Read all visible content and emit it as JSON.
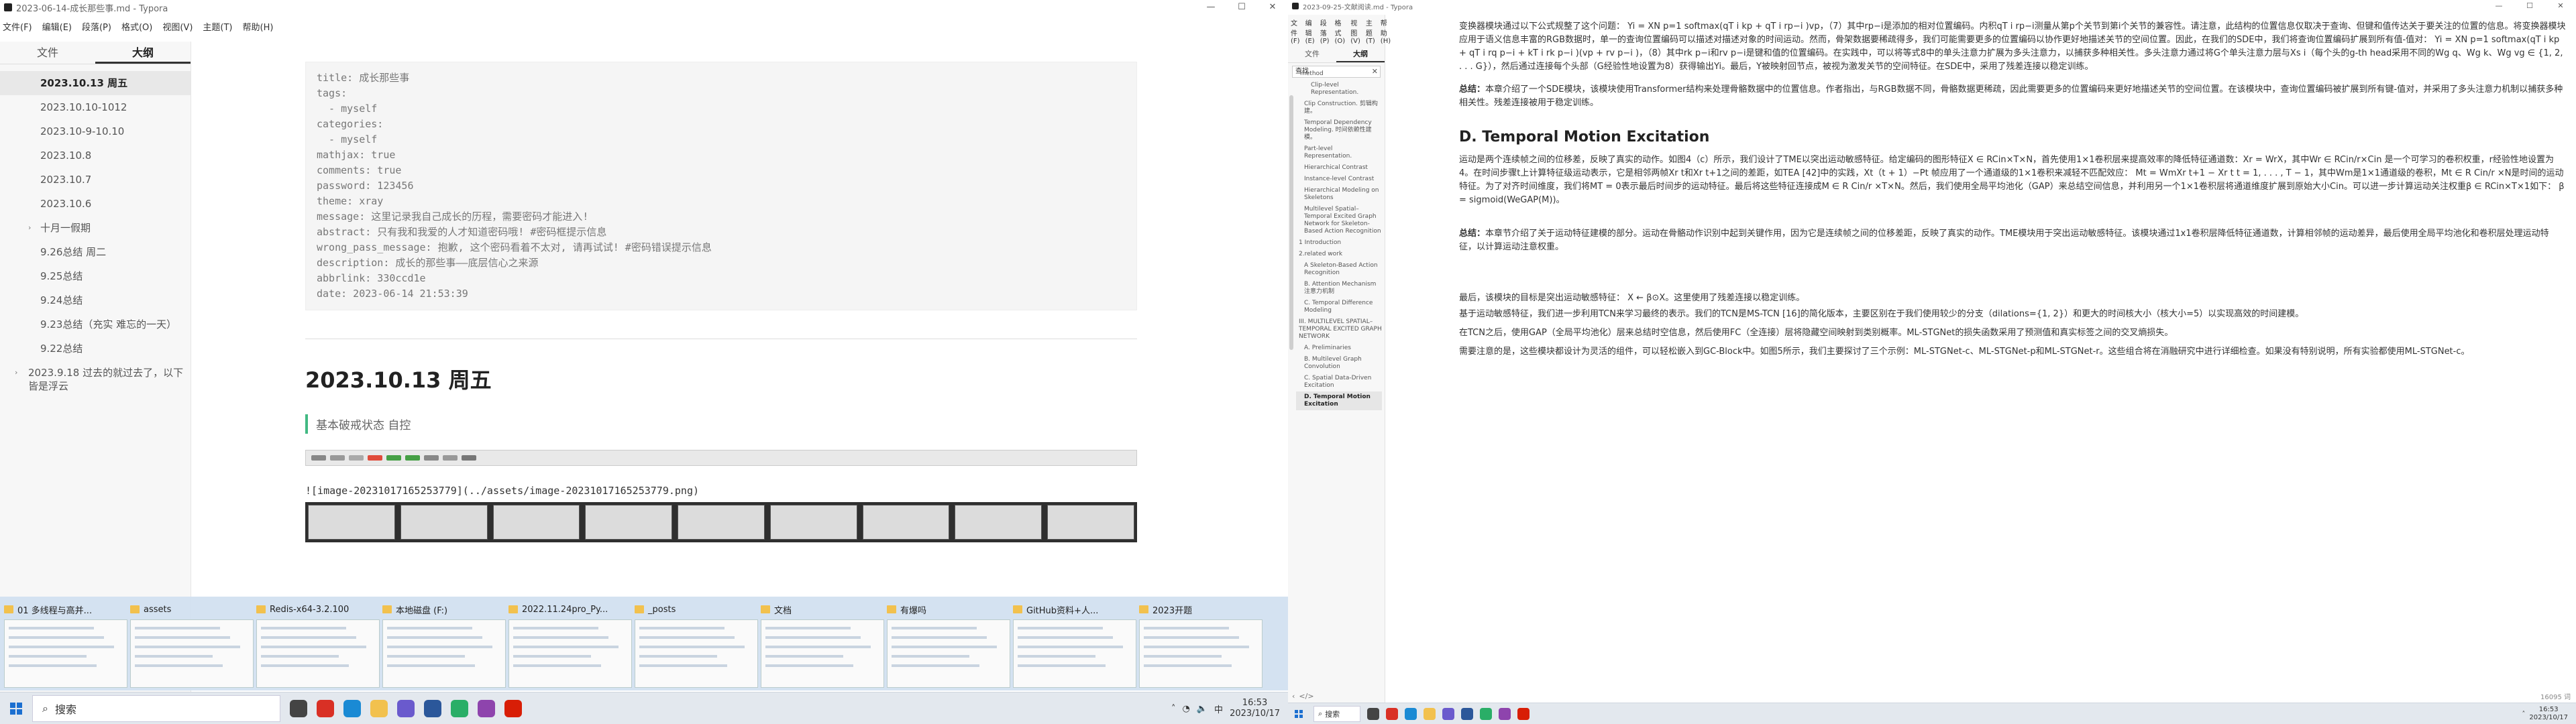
{
  "left_window": {
    "title": "2023-06-14-成长那些事.md - Typora",
    "menu": [
      "文件(F)",
      "编辑(E)",
      "段落(P)",
      "格式(O)",
      "视图(V)",
      "主题(T)",
      "帮助(H)"
    ],
    "sidebar_tabs": [
      "文件",
      "大纲"
    ],
    "active_tab": "大纲",
    "outline": [
      {
        "label": "2023.10.13 周五",
        "active": true,
        "level": 2,
        "caret": false
      },
      {
        "label": "2023.10.10-1012",
        "active": false,
        "level": 2,
        "caret": false
      },
      {
        "label": "2023.10-9-10.10",
        "active": false,
        "level": 2,
        "caret": false
      },
      {
        "label": "2023.10.8",
        "active": false,
        "level": 2,
        "caret": false
      },
      {
        "label": "2023.10.7",
        "active": false,
        "level": 2,
        "caret": false
      },
      {
        "label": "2023.10.6",
        "active": false,
        "level": 2,
        "caret": false
      },
      {
        "label": "十月一假期",
        "active": false,
        "level": 2,
        "caret": true
      },
      {
        "label": "9.26总结 周二",
        "active": false,
        "level": 2,
        "caret": false
      },
      {
        "label": "9.25总结",
        "active": false,
        "level": 2,
        "caret": false
      },
      {
        "label": "9.24总结",
        "active": false,
        "level": 2,
        "caret": false
      },
      {
        "label": "9.23总结（充实 难忘的一天）",
        "active": false,
        "level": 2,
        "caret": false
      },
      {
        "label": "9.22总结",
        "active": false,
        "level": 2,
        "caret": false
      },
      {
        "label": "2023.9.18 过去的就过去了，以下皆是浮云",
        "active": false,
        "level": 1,
        "caret": true
      }
    ],
    "front_matter": [
      "title: 成长那些事",
      "tags:",
      "  - myself",
      "categories:",
      "  - myself",
      "mathjax: true",
      "comments: true",
      "password: 123456",
      "theme: xray",
      "message: 这里记录我自己成长的历程，需要密码才能进入!",
      "abstract: 只有我和我爱的人才知道密码哦! #密码框提示信息",
      "wrong_pass_message: 抱歉, 这个密码看着不太对, 请再试试! #密码错误提示信息",
      "description: 成长的那些事——底层信心之来源",
      "abbrlink: 330ccd1e",
      "date: 2023-06-14 21:53:39"
    ],
    "heading": "2023.10.13 周五",
    "quote": "基本破戒状态 自控",
    "image_ref": "![image-20231017165253779](../assets/image-20231017165253779.png)"
  },
  "thumbnails": [
    {
      "label": "01 多线程与高并...",
      "icon": "folder-icon"
    },
    {
      "label": "assets",
      "icon": "folder-icon"
    },
    {
      "label": "Redis-x64-3.2.100",
      "icon": "folder-icon"
    },
    {
      "label": "本地磁盘 (F:)",
      "icon": "drive-icon"
    },
    {
      "label": "2022.11.24pro_Py...",
      "icon": "folder-icon"
    },
    {
      "label": "_posts",
      "icon": "folder-icon"
    },
    {
      "label": "文档",
      "icon": "folder-icon"
    },
    {
      "label": "有爆吗",
      "icon": "folder-icon"
    },
    {
      "label": "GitHub资料+人...",
      "icon": "folder-icon"
    },
    {
      "label": "2023开题",
      "icon": "folder-icon"
    }
  ],
  "taskbar": {
    "search_placeholder": "搜索",
    "time": "16:53",
    "date": "2023/10/17",
    "lang": "中",
    "icons": [
      {
        "name": "task-view-icon",
        "color": "#444444"
      },
      {
        "name": "chrome-icon",
        "color": "#d93025"
      },
      {
        "name": "edge-icon",
        "color": "#1a8ad4"
      },
      {
        "name": "file-explorer-icon",
        "color": "#f2c14e"
      },
      {
        "name": "typora-icon",
        "color": "#6a5acd"
      },
      {
        "name": "app-icon",
        "color": "#2b579a"
      },
      {
        "name": "wechat-icon",
        "color": "#2aae67"
      },
      {
        "name": "app2-icon",
        "color": "#8e44ad"
      },
      {
        "name": "netease-music-icon",
        "color": "#d81e06"
      }
    ]
  },
  "right_window": {
    "title": "2023-09-25-文献阅读.md - Typora",
    "menu": [
      "文件(F)",
      "编辑(E)",
      "段落(P)",
      "格式(O)",
      "视图(V)",
      "主题(T)",
      "帮助(H)"
    ],
    "sidebar_tabs": [
      "文件",
      "大纲"
    ],
    "search_value": "查找",
    "outline": [
      {
        "label": "method",
        "active": false
      },
      {
        "label": "Clip-level Representation.",
        "active": false
      },
      {
        "label": "Clip Construction. 剪辑构建。",
        "active": false
      },
      {
        "label": "Temporal Dependency Modeling. 时间依赖性建模。",
        "active": false
      },
      {
        "label": "Part-level Representation.",
        "active": false
      },
      {
        "label": "Hierarchical Contrast",
        "active": false
      },
      {
        "label": "Instance-level Contrast",
        "active": false
      },
      {
        "label": "Hierarchical Modeling on Skeletons",
        "active": false
      },
      {
        "label": "Multilevel Spatial–Temporal Excited Graph Network for Skeleton-Based Action Recognition",
        "active": false
      },
      {
        "label": "1 Introduction",
        "active": false
      },
      {
        "label": "2.related work",
        "active": false
      },
      {
        "label": "A Skeleton-Based Action Recognition",
        "active": false
      },
      {
        "label": "B. Attention Mechanism 注意力机制",
        "active": false
      },
      {
        "label": "C. Temporal Difference Modeling",
        "active": false
      },
      {
        "label": "III. MULTILEVEL SPATIAL–TEMPORAL EXCITED GRAPH NETWORK",
        "active": false
      },
      {
        "label": "A. Preliminaries",
        "active": false
      },
      {
        "label": "B. Multilevel Graph Convolution",
        "active": false
      },
      {
        "label": "C. Spatial Data-Driven Excitation",
        "active": false
      },
      {
        "label": "D. Temporal Motion Excitation",
        "active": true
      }
    ],
    "para1": "变换器模块通过以下公式规整了这个问题： Yi = XN p=1 softmax(qT i kp + qT i rp−i )vp，（7）其中rp−i是添加的相对位置编码。内积qT i rp−i测量从第p个关节到第i个关节的兼容性。请注意，此结构的位置信息仅取决于查询、但键和值传达关于要关注的位置的信息。将变换器模块应用于语义信息丰富的RGB数据时，单一的查询位置编码可以描述对描述对象的时间运动。然而，骨架数据要稀疏得多，我们可能需要更多的位置编码以协作更好地描述关节的空间位置。因此，在我们的SDE中，我们将查询位置编码扩展到所有值-值对： Yi = XN p=1 softmax(qT i kp + qT i rq p−i + kT i rk p−i )(vp + rv p−i )，（8）其中rk p−i和rv p−i是键和值的位置编码。在实践中，可以将等式8中的单头注意力扩展为多头注意力，以捕获多种相关性。多头注意力通过将G个单头注意力层与Xs i（每个头的g-th head采用不同的Wg q、Wg k、Wg vg ∈ {1, 2, . . . G}），然后通过连接每个头部（G经验性地设置为8）获得输出Yi。最后，Y被映射回节点，被视为激发关节的空间特征。在SDE中，采用了残差连接以稳定训练。",
    "summary1": "本章介绍了一个SDE模块，该模块使用Transformer结构来处理骨骼数据中的位置信息。作者指出，与RGB数据不同，骨骼数据更稀疏，因此需要更多的位置编码来更好地描述关节的空间位置。在该模块中，查询位置编码被扩展到所有键-值对，并采用了多头注意力机制以捕获多种相关性。残差连接被用于稳定训练。",
    "heading": "D. Temporal Motion Excitation",
    "para2": "运动是两个连续帧之间的位移差，反映了真实的动作。如图4（c）所示，我们设计了TME以突出运动敏感特征。给定编码的图形特征X ∈ RCin×T×N，首先使用1×1卷积层来提高效率的降低特征通道数：Xr = WrX，其中Wr ∈ RCin/r×Cin 是一个可学习的卷积权重，r经验性地设置为4。在时间步骤t上计算特征级运动表示，它是相邻两帧Xr t和Xr t+1之间的差距，如TEA [42]中的实践，Xt（t + 1）−Pt 帧应用了一个通道级的1×1卷积来减轻不匹配效应： Mt = WmXr t+1 − Xr t t = 1, . . . , T − 1，其中Wm是1×1通道级的卷积，Mt ∈ R Cin/r ×N是时间的运动特征。为了对齐时间维度，我们将MT = 0表示最后时间步的运动特征。最后将这些特征连接成M ∈ R Cin/r ×T×N。然后，我们使用全局平均池化（GAP）来总结空间信息，并利用另一个1×1卷积层将通道维度扩展到原始大小Cin。可以进一步计算运动关注权重β ∈ RCin×T×1如下： β = sigmoid(WeGAP(M))。",
    "summary2": "本章节介绍了关于运动特征建模的部分。运动在骨骼动作识别中起到关键作用，因为它是连续帧之间的位移差距，反映了真实的动作。TME模块用于突出运动敏感特征。该模块通过1x1卷积层降低特征通道数，计算相邻帧的运动差异，最后使用全局平均池化和卷积层处理运动特征，以计算运动注意权重。",
    "para3": "最后，该模块的目标是突出运动敏感特征： X ← β⊙X。这里使用了残差连接以稳定训练。",
    "para4": "基于运动敏感特征，我们进一步利用TCN来学习最终的表示。我们的TCN是MS-TCN [16]的简化版本，主要区别在于我们使用较少的分支（dilations={1, 2}）和更大的时间核大小（核大小=5）以实现高效的时间建模。",
    "para5": "在TCN之后，使用GAP（全局平均池化）层来总结时空信息，然后使用FC（全连接）层将隐藏空间映射到类别概率。ML-STGNet的损失函数采用了预测值和真实标签之间的交叉熵损失。",
    "para6": "需要注意的是，这些模块都设计为灵活的组件，可以轻松嵌入到GC-Block中。如图5所示，我们主要探讨了三个示例：ML-STGNet-c、ML-STGNet-p和ML-STGNet-r。这些组合将在消融研究中进行详细检查。如果没有特别说明，所有实验都使用ML-STGNet-c。",
    "word_count": "16095 词",
    "time": "16:53",
    "date": "2023/10/17"
  }
}
